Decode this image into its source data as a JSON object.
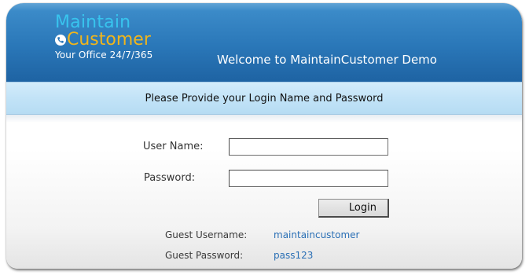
{
  "header": {
    "logo_line1": "Maintain",
    "logo_line2": "Customer",
    "tagline": "Your Office 24/7/365",
    "welcome": "Welcome to MaintainCustomer Demo"
  },
  "form": {
    "heading": "Please Provide your Login Name and Password",
    "username_label": "User Name:",
    "username_value": "",
    "password_label": "Password:",
    "password_value": "",
    "login_button": "Login"
  },
  "guest": {
    "username_label": "Guest Username:",
    "username_value": "maintaincustomer",
    "password_label": "Guest Password:",
    "password_value": "pass123"
  },
  "colors": {
    "header_blue": "#2a77b8",
    "logo_maintain": "#38c4ee",
    "logo_customer": "#f0b51c",
    "subheader": "#c2e3f7",
    "link": "#2a6fb5"
  },
  "icons": {
    "logo_badge": "phone-icon"
  }
}
